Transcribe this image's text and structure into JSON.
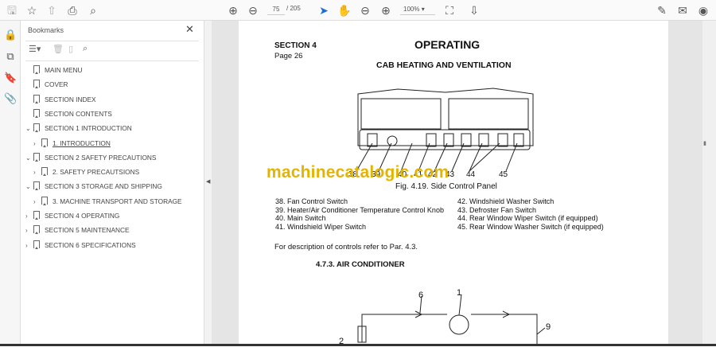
{
  "toolbar": {
    "page_current": "75",
    "page_total": "/ 205",
    "zoom": "100%"
  },
  "bookmarks": {
    "title": "Bookmarks",
    "items": [
      {
        "label": "MAIN MENU",
        "level": 0,
        "caret": ""
      },
      {
        "label": "COVER",
        "level": 0,
        "caret": ""
      },
      {
        "label": "SECTION INDEX",
        "level": 0,
        "caret": ""
      },
      {
        "label": "SECTION CONTENTS",
        "level": 0,
        "caret": ""
      },
      {
        "label": "SECTION 1 INTRODUCTION",
        "level": 0,
        "caret": "v"
      },
      {
        "label": "1. INTRODUCTION",
        "level": 1,
        "caret": ">"
      },
      {
        "label": "SECTION 2 SAFETY PRECAUTIONS",
        "level": 0,
        "caret": "v"
      },
      {
        "label": "2. SAFETY PRECAUTSIONS",
        "level": 1,
        "caret": ">"
      },
      {
        "label": "SECTION 3 STORAGE AND SHIPPING",
        "level": 0,
        "caret": "v"
      },
      {
        "label": "3. MACHINE TRANSPORT AND STORAGE",
        "level": 1,
        "caret": ">"
      },
      {
        "label": "SECTION 4 OPERATING",
        "level": 0,
        "caret": ">"
      },
      {
        "label": "SECTION 5 MAINTENANCE",
        "level": 0,
        "caret": ">"
      },
      {
        "label": "SECTION 6 SPECIFICATIONS",
        "level": 0,
        "caret": ">"
      }
    ]
  },
  "document": {
    "section": "SECTION 4",
    "page": "Page 26",
    "heading": "OPERATING",
    "subheading": "CAB HEATING AND VENTILATION",
    "callouts": [
      "38",
      "39",
      "40",
      "41",
      "42",
      "43",
      "44",
      "45"
    ],
    "figure_caption": "Fig. 4.19. Side Control Panel",
    "legend_left": [
      "38. Fan Control Switch",
      "39. Heater/Air Conditioner Temperature Control Knob",
      "40. Main Switch",
      "41. Windshield Wiper Switch"
    ],
    "legend_right": [
      "42. Windshield Washer Switch",
      "43. Defroster Fan Switch",
      "44. Rear Window Wiper Switch (if equipped)",
      "45. Rear Window Washer Switch (if equipped)"
    ],
    "reference": "For description of controls refer to Par. 4.3.",
    "section_title": "4.7.3. AIR CONDITIONER",
    "diagram2_labels": [
      "6",
      "1",
      "9",
      "2"
    ],
    "watermark": "machinecatalogic.com"
  }
}
